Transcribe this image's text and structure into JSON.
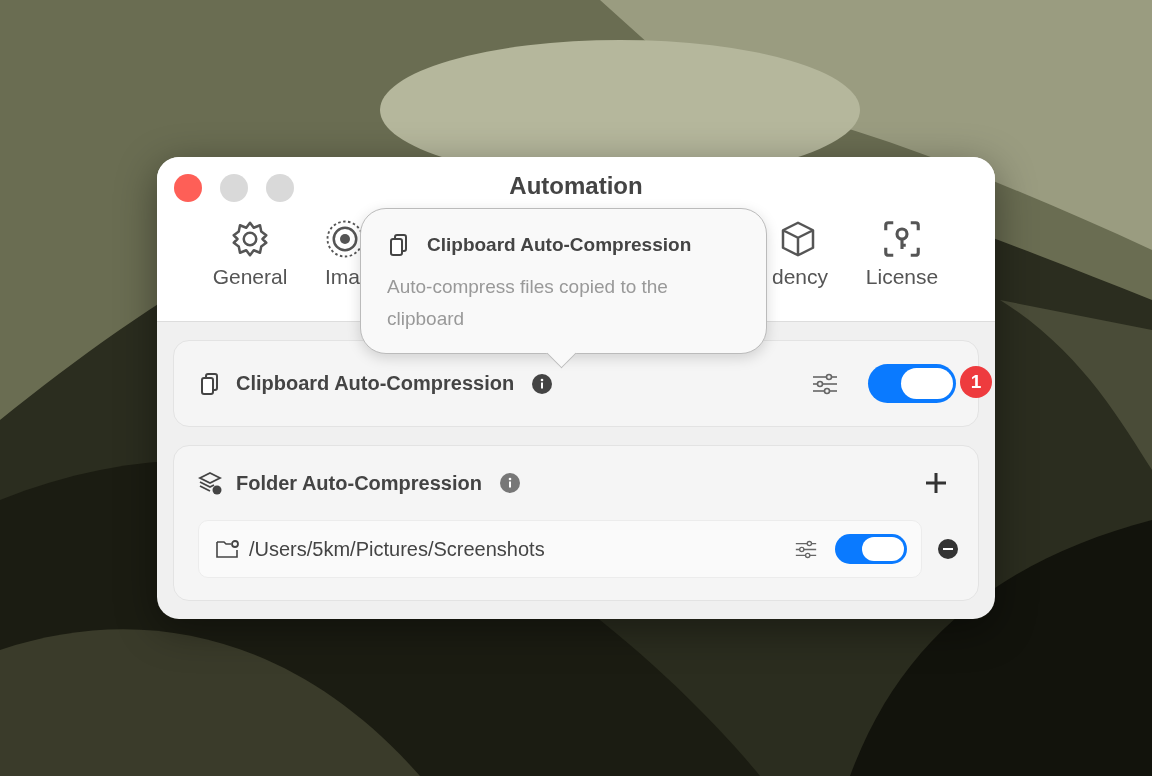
{
  "window": {
    "title": "Automation"
  },
  "tabs": [
    {
      "label": "General"
    },
    {
      "label": "Ima"
    },
    {
      "label": "dency"
    },
    {
      "label": "License"
    }
  ],
  "tooltip": {
    "title": "Clipboard Auto-Compression",
    "text": "Auto-compress files copied to the clipboard"
  },
  "clipboard": {
    "title": "Clipboard Auto-Compression",
    "on": true,
    "badge": "1"
  },
  "folder": {
    "title": "Folder Auto-Compression",
    "folders": [
      {
        "path": "/Users/5km/Pictures/Screenshots",
        "on": true
      }
    ]
  }
}
